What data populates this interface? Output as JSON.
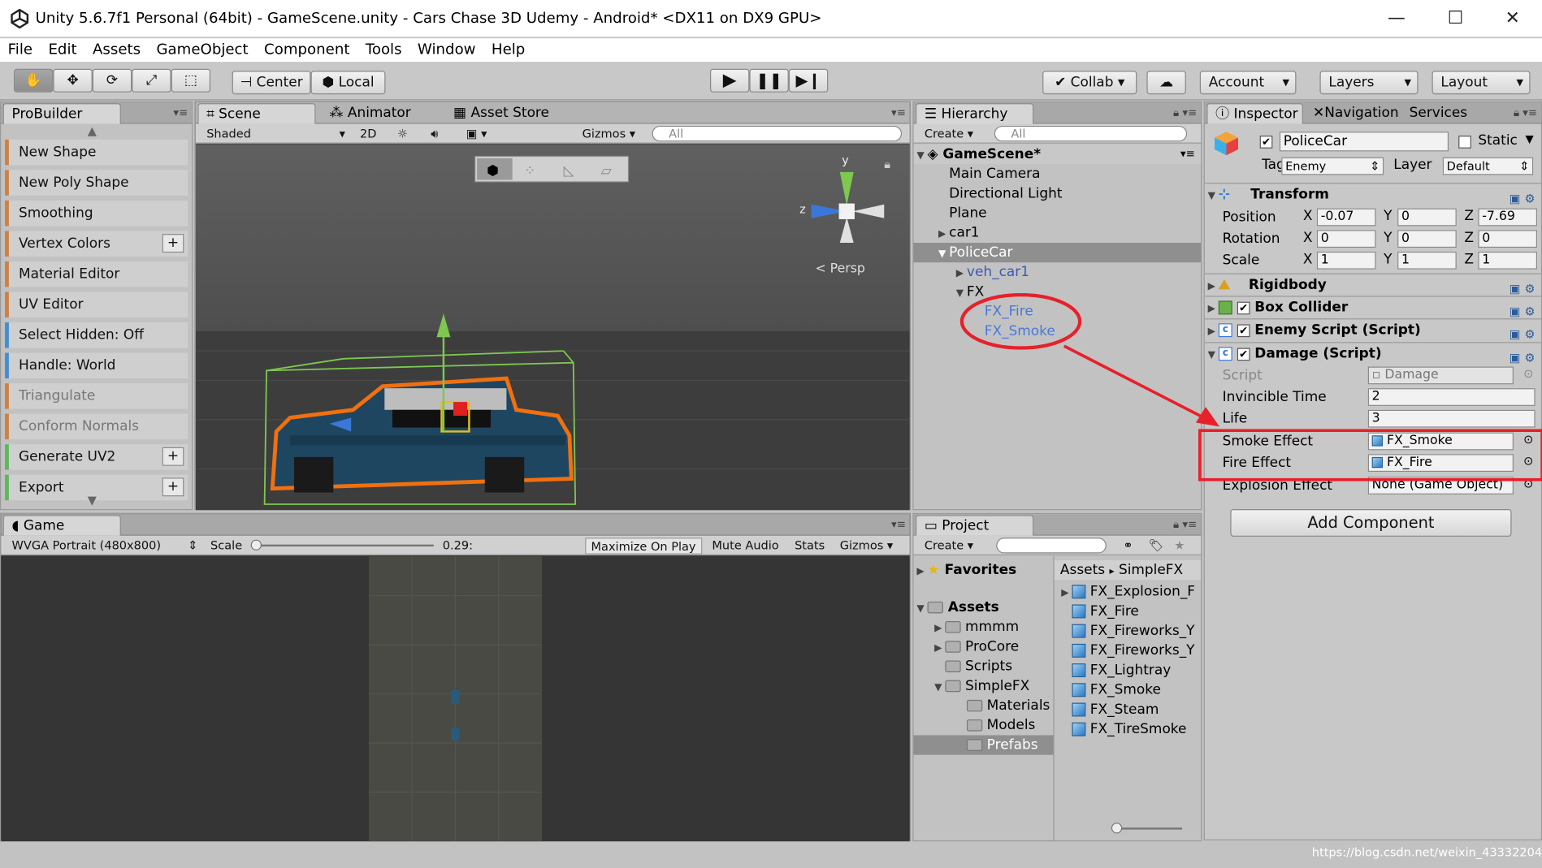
{
  "title_bar": {
    "title": "Unity 5.6.7f1 Personal (64bit) - GameScene.unity - Cars Chase 3D Udemy - Android* <DX11 on DX9 GPU>",
    "minimize": "—",
    "maximize": "☐",
    "close": "✕"
  },
  "menu": [
    "File",
    "Edit",
    "Assets",
    "GameObject",
    "Component",
    "Tools",
    "Window",
    "Help"
  ],
  "toolbar": {
    "center": "Center",
    "local": "Local",
    "collab": "Collab",
    "account": "Account",
    "layers": "Layers",
    "layout": "Layout"
  },
  "probuilder": {
    "tab": "ProBuilder",
    "items": [
      {
        "label": "New Shape",
        "plus": ""
      },
      {
        "label": "New Poly Shape",
        "plus": ""
      },
      {
        "label": "Smoothing",
        "plus": ""
      },
      {
        "label": "Vertex Colors",
        "plus": "+"
      },
      {
        "label": "Material Editor",
        "plus": ""
      },
      {
        "label": "UV Editor",
        "plus": ""
      },
      {
        "label": "Select Hidden: Off",
        "plus": ""
      },
      {
        "label": "Handle: World",
        "plus": ""
      },
      {
        "label": "Triangulate",
        "plus": ""
      },
      {
        "label": "Conform Normals",
        "plus": ""
      },
      {
        "label": "Generate UV2",
        "plus": "+"
      },
      {
        "label": "Export",
        "plus": "+"
      }
    ]
  },
  "scene": {
    "tabs": [
      "Scene",
      "Animator",
      "Asset Store"
    ],
    "shading": "Shaded",
    "mode2d": "2D",
    "gizmos": "Gizmos",
    "search": "All",
    "persp": "Persp",
    "axis_y": "y",
    "axis_z": "z"
  },
  "game": {
    "tab": "Game",
    "resolution": "WVGA Portrait (480x800)",
    "scale_label": "Scale",
    "scale_value": "0.29:",
    "maximize": "Maximize On Play",
    "mute": "Mute Audio",
    "stats": "Stats",
    "gizmos": "Gizmos"
  },
  "hierarchy": {
    "tab": "Hierarchy",
    "create": "Create",
    "search": "All",
    "scene_name": "GameScene*",
    "items": [
      "Main Camera",
      "Directional Light",
      "Plane",
      "car1",
      "PoliceCar",
      "veh_car1",
      "FX",
      "FX_Fire",
      "FX_Smoke"
    ]
  },
  "project": {
    "tab": "Project",
    "create": "Create",
    "favorites": "Favorites",
    "assets": "Assets",
    "folders": [
      "mmmm",
      "ProCore",
      "Scripts",
      "SimpleFX",
      "Materials",
      "Models",
      "Prefabs"
    ],
    "breadcrumb_root": "Assets",
    "breadcrumb_sep": "▸",
    "breadcrumb_leaf": "SimpleFX",
    "files": [
      "FX_Explosion_F",
      "FX_Fire",
      "FX_Fireworks_Y",
      "FX_Fireworks_Y",
      "FX_Lightray",
      "FX_Smoke",
      "FX_Steam",
      "FX_TireSmoke"
    ]
  },
  "inspector": {
    "tabs": [
      "Inspector",
      "Navigation",
      "Services"
    ],
    "object_name": "PoliceCar",
    "static_label": "Static",
    "tag_label": "Tag",
    "tag_value": "Enemy",
    "layer_label": "Layer",
    "layer_value": "Default",
    "transform": {
      "title": "Transform",
      "position_label": "Position",
      "rotation_label": "Rotation",
      "scale_label": "Scale",
      "x": "X",
      "y": "Y",
      "z": "Z",
      "position": [
        "-0.07",
        "0",
        "-7.69"
      ],
      "rotation": [
        "0",
        "0",
        "0"
      ],
      "scale": [
        "1",
        "1",
        "1"
      ]
    },
    "rigidbody": "Rigidbody",
    "box_collider": "Box Collider",
    "enemy_script": "Enemy Script (Script)",
    "damage": {
      "title": "Damage (Script)",
      "script_label": "Script",
      "script_value": "Damage",
      "invincible_label": "Invincible Time",
      "invincible_value": "2",
      "life_label": "Life",
      "life_value": "3",
      "smoke_label": "Smoke Effect",
      "smoke_value": "FX_Smoke",
      "fire_label": "Fire Effect",
      "fire_value": "FX_Fire",
      "explosion_label": "Explosion Effect",
      "explosion_value": "None (Game Object)"
    },
    "add_component": "Add Component"
  },
  "watermark": "https://blog.csdn.net/weixin_43332204",
  "colors": {
    "annotation_red": "#e8202a",
    "selection_orange": "#f07010",
    "prefab_blue": "#3c5ab4"
  }
}
